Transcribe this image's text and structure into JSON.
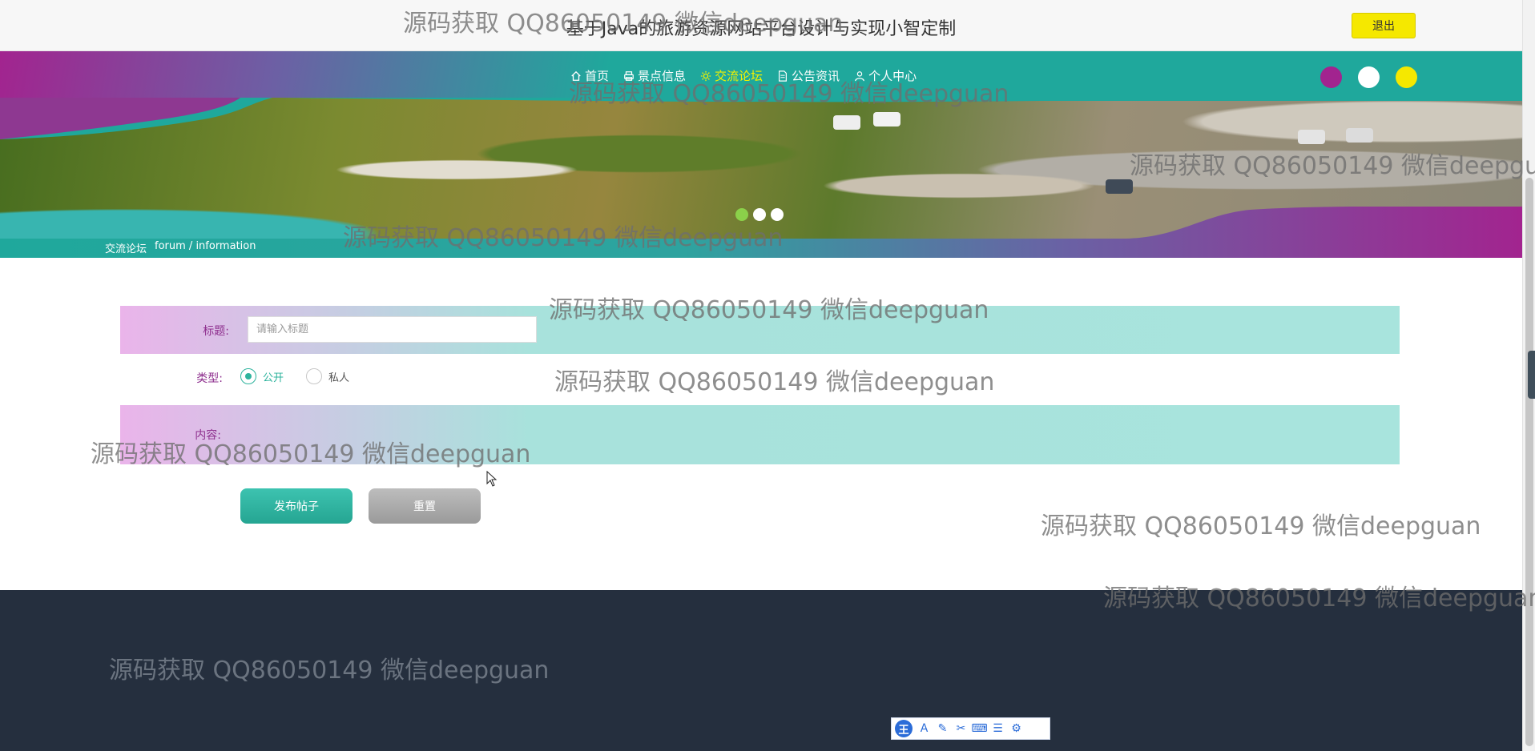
{
  "header": {
    "site_title": "基于Java的旅游资源网站平台设计与实现小智定制",
    "logout_label": "退出"
  },
  "nav": {
    "items": [
      {
        "label": "首页",
        "icon": "home-icon"
      },
      {
        "label": "景点信息",
        "icon": "printer-icon"
      },
      {
        "label": "交流论坛",
        "icon": "gear-icon",
        "active": true
      },
      {
        "label": "公告资讯",
        "icon": "document-icon"
      },
      {
        "label": "个人中心",
        "icon": "user-icon"
      }
    ],
    "active_color": "#f2f200",
    "theme_colors": [
      "#a2248f",
      "#ffffff",
      "#f5e800"
    ]
  },
  "banner": {
    "slide_count": 3,
    "active_slide": 1
  },
  "breadcrumb": {
    "current": "交流论坛",
    "path": "forum / information"
  },
  "form": {
    "title_label": "标题:",
    "title_placeholder": "请输入标题",
    "type_label": "类型:",
    "type_options": [
      "公开",
      "私人"
    ],
    "type_selected": "公开",
    "content_label": "内容:",
    "submit_label": "发布帖子",
    "reset_label": "重置"
  },
  "watermark_text": "源码获取 QQ86050149 微信deepguan",
  "ime": {
    "logo": "王",
    "tools": [
      "A",
      "✎",
      "✂",
      "⌨",
      "☰",
      "⚙"
    ]
  },
  "colors": {
    "teal": "#1fa89c",
    "purple": "#a2248f",
    "footer": "#252f3e",
    "logout_bg": "#f5e800"
  }
}
